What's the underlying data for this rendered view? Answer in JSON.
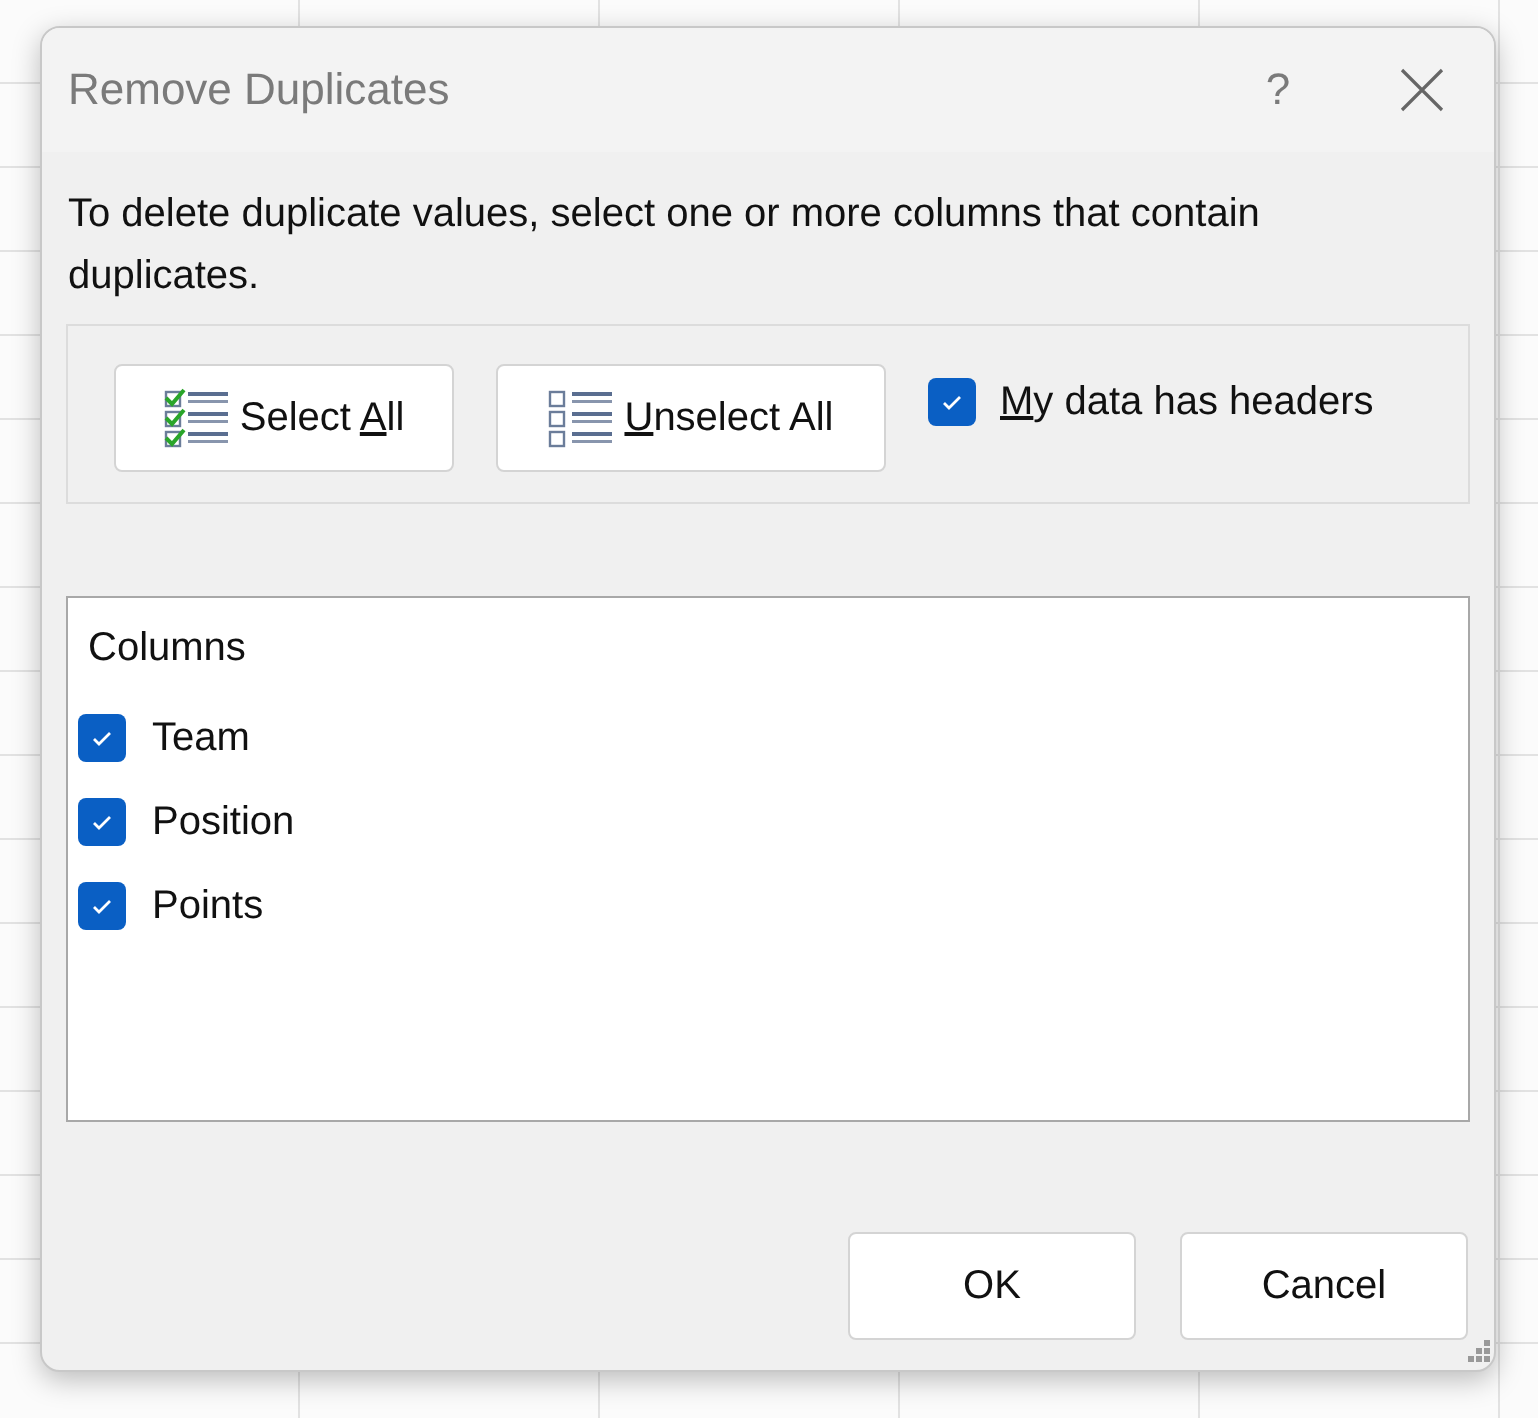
{
  "window": {
    "title": "Remove Duplicates",
    "help": "?"
  },
  "description": "To delete duplicate values, select one or more columns that contain duplicates.",
  "toolbar": {
    "buttons": [
      {
        "kind": "select",
        "before": "Select ",
        "key": "A",
        "after": "ll"
      },
      {
        "kind": "unselect",
        "key": "U",
        "after": "nselect All"
      }
    ],
    "headers": {
      "key": "M",
      "after": "y data has headers",
      "checked": true
    }
  },
  "columns": {
    "heading": "Columns",
    "items": [
      {
        "label": "Team",
        "checked": true
      },
      {
        "label": "Position",
        "checked": true
      },
      {
        "label": "Points",
        "checked": true
      }
    ]
  },
  "buttons": [
    "OK",
    "Cancel"
  ]
}
